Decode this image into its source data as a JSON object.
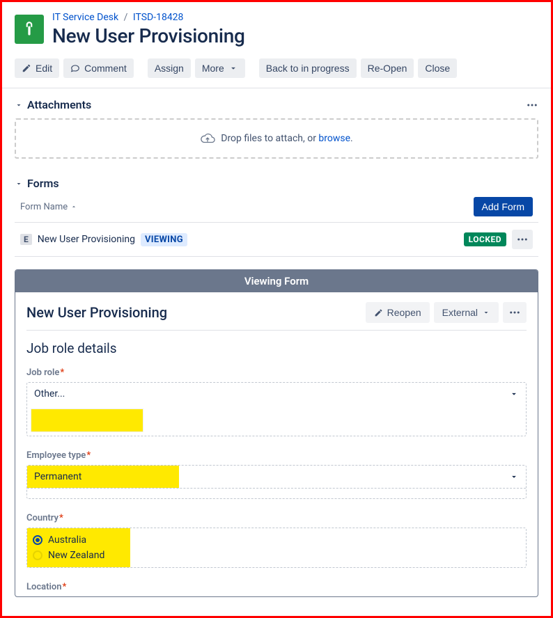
{
  "breadcrumb": {
    "project": "IT Service Desk",
    "issue_key": "ITSD-18428"
  },
  "page_title": "New User Provisioning",
  "toolbar": {
    "edit": "Edit",
    "comment": "Comment",
    "assign": "Assign",
    "more": "More",
    "back": "Back to in progress",
    "reopen": "Re-Open",
    "close": "Close"
  },
  "sections": {
    "attachments": {
      "title": "Attachments",
      "drop_prefix": "Drop files to attach, or ",
      "browse": "browse",
      "drop_suffix": "."
    },
    "forms": {
      "title": "Forms",
      "col_header": "Form Name",
      "add_form": "Add Form",
      "row": {
        "type_badge": "E",
        "name": "New User Provisioning",
        "status": "VIEWING",
        "locked": "LOCKED"
      }
    }
  },
  "form_viewer": {
    "banner": "Viewing Form",
    "title": "New User Provisioning",
    "actions": {
      "reopen": "Reopen",
      "external": "External"
    },
    "section_title": "Job role details",
    "fields": {
      "job_role": {
        "label": "Job role",
        "value": "Other..."
      },
      "employee_type": {
        "label": "Employee type",
        "value": "Permanent"
      },
      "country": {
        "label": "Country",
        "options": [
          "Australia",
          "New Zealand"
        ],
        "selected": "Australia"
      },
      "location": {
        "label": "Location"
      }
    }
  }
}
